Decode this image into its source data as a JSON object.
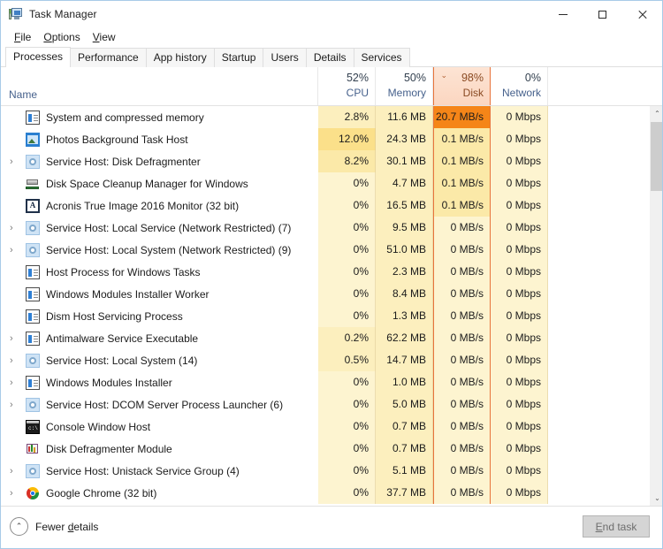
{
  "window": {
    "title": "Task Manager",
    "icon": "taskmanager-icon",
    "minimize": "—",
    "maximize": "□",
    "close": "✕"
  },
  "menu": [
    {
      "label": "File",
      "accel": "F"
    },
    {
      "label": "Options",
      "accel": "O"
    },
    {
      "label": "View",
      "accel": "V"
    }
  ],
  "tabs": [
    {
      "label": "Processes",
      "active": true
    },
    {
      "label": "Performance",
      "active": false
    },
    {
      "label": "App history",
      "active": false
    },
    {
      "label": "Startup",
      "active": false
    },
    {
      "label": "Users",
      "active": false
    },
    {
      "label": "Details",
      "active": false
    },
    {
      "label": "Services",
      "active": false
    }
  ],
  "columns": {
    "name_label": "Name",
    "metrics": [
      {
        "key": "cpu",
        "percent": "52%",
        "label": "CPU",
        "sorted": false
      },
      {
        "key": "memory",
        "percent": "50%",
        "label": "Memory",
        "sorted": false
      },
      {
        "key": "disk",
        "percent": "98%",
        "label": "Disk",
        "sorted": true,
        "sort_caret": "⌄"
      },
      {
        "key": "network",
        "percent": "0%",
        "label": "Network",
        "sorted": false
      }
    ]
  },
  "accent": {
    "sort_border": "#e8743c",
    "sort_header_bg": "#fbd6c0",
    "heat_max": "#f58518",
    "heat_base": "#fdf4d0"
  },
  "processes": [
    {
      "name": "System and compressed memory",
      "icon": "system-icon",
      "expandable": false,
      "cpu": "2.8%",
      "memory": "11.6 MB",
      "disk": "20.7 MB/s",
      "network": "0 Mbps",
      "cpu_heat": "h1",
      "mem_heat": "h1",
      "disk_heat": "h5",
      "net_heat": "h0"
    },
    {
      "name": "Photos Background Task Host",
      "icon": "photos-icon",
      "expandable": false,
      "cpu": "12.0%",
      "memory": "24.3 MB",
      "disk": "0.1 MB/s",
      "network": "0 Mbps",
      "cpu_heat": "h3",
      "mem_heat": "h1",
      "disk_heat": "h2",
      "net_heat": "h0"
    },
    {
      "name": "Service Host: Disk Defragmenter",
      "icon": "gear-icon",
      "expandable": true,
      "cpu": "8.2%",
      "memory": "30.1 MB",
      "disk": "0.1 MB/s",
      "network": "0 Mbps",
      "cpu_heat": "h2",
      "mem_heat": "h1",
      "disk_heat": "h2",
      "net_heat": "h0"
    },
    {
      "name": "Disk Space Cleanup Manager for Windows",
      "icon": "cleanup-icon",
      "expandable": false,
      "cpu": "0%",
      "memory": "4.7 MB",
      "disk": "0.1 MB/s",
      "network": "0 Mbps",
      "cpu_heat": "h0",
      "mem_heat": "h1",
      "disk_heat": "h2",
      "net_heat": "h0"
    },
    {
      "name": "Acronis True Image 2016 Monitor (32 bit)",
      "icon": "acronis-icon",
      "expandable": false,
      "cpu": "0%",
      "memory": "16.5 MB",
      "disk": "0.1 MB/s",
      "network": "0 Mbps",
      "cpu_heat": "h0",
      "mem_heat": "h1",
      "disk_heat": "h2",
      "net_heat": "h0"
    },
    {
      "name": "Service Host: Local Service (Network Restricted) (7)",
      "icon": "gear-icon",
      "expandable": true,
      "cpu": "0%",
      "memory": "9.5 MB",
      "disk": "0 MB/s",
      "network": "0 Mbps",
      "cpu_heat": "h0",
      "mem_heat": "h1",
      "disk_heat": "h0",
      "net_heat": "h0"
    },
    {
      "name": "Service Host: Local System (Network Restricted) (9)",
      "icon": "gear-icon",
      "expandable": true,
      "cpu": "0%",
      "memory": "51.0 MB",
      "disk": "0 MB/s",
      "network": "0 Mbps",
      "cpu_heat": "h0",
      "mem_heat": "h1",
      "disk_heat": "h0",
      "net_heat": "h0"
    },
    {
      "name": "Host Process for Windows Tasks",
      "icon": "system-icon",
      "expandable": false,
      "cpu": "0%",
      "memory": "2.3 MB",
      "disk": "0 MB/s",
      "network": "0 Mbps",
      "cpu_heat": "h0",
      "mem_heat": "h1",
      "disk_heat": "h0",
      "net_heat": "h0"
    },
    {
      "name": "Windows Modules Installer Worker",
      "icon": "system-icon",
      "expandable": false,
      "cpu": "0%",
      "memory": "8.4 MB",
      "disk": "0 MB/s",
      "network": "0 Mbps",
      "cpu_heat": "h0",
      "mem_heat": "h1",
      "disk_heat": "h0",
      "net_heat": "h0"
    },
    {
      "name": "Dism Host Servicing Process",
      "icon": "system-icon",
      "expandable": false,
      "cpu": "0%",
      "memory": "1.3 MB",
      "disk": "0 MB/s",
      "network": "0 Mbps",
      "cpu_heat": "h0",
      "mem_heat": "h1",
      "disk_heat": "h0",
      "net_heat": "h0"
    },
    {
      "name": "Antimalware Service Executable",
      "icon": "system-icon",
      "expandable": true,
      "cpu": "0.2%",
      "memory": "62.2 MB",
      "disk": "0 MB/s",
      "network": "0 Mbps",
      "cpu_heat": "h1",
      "mem_heat": "h1",
      "disk_heat": "h0",
      "net_heat": "h0"
    },
    {
      "name": "Service Host: Local System (14)",
      "icon": "gear-icon",
      "expandable": true,
      "cpu": "0.5%",
      "memory": "14.7 MB",
      "disk": "0 MB/s",
      "network": "0 Mbps",
      "cpu_heat": "h1",
      "mem_heat": "h1",
      "disk_heat": "h0",
      "net_heat": "h0"
    },
    {
      "name": "Windows Modules Installer",
      "icon": "system-icon",
      "expandable": true,
      "cpu": "0%",
      "memory": "1.0 MB",
      "disk": "0 MB/s",
      "network": "0 Mbps",
      "cpu_heat": "h0",
      "mem_heat": "h1",
      "disk_heat": "h0",
      "net_heat": "h0"
    },
    {
      "name": "Service Host: DCOM Server Process Launcher (6)",
      "icon": "gear-icon",
      "expandable": true,
      "cpu": "0%",
      "memory": "5.0 MB",
      "disk": "0 MB/s",
      "network": "0 Mbps",
      "cpu_heat": "h0",
      "mem_heat": "h1",
      "disk_heat": "h0",
      "net_heat": "h0"
    },
    {
      "name": "Console Window Host",
      "icon": "console-icon",
      "expandable": false,
      "cpu": "0%",
      "memory": "0.7 MB",
      "disk": "0 MB/s",
      "network": "0 Mbps",
      "cpu_heat": "h0",
      "mem_heat": "h1",
      "disk_heat": "h0",
      "net_heat": "h0"
    },
    {
      "name": "Disk Defragmenter Module",
      "icon": "defrag-icon",
      "expandable": false,
      "cpu": "0%",
      "memory": "0.7 MB",
      "disk": "0 MB/s",
      "network": "0 Mbps",
      "cpu_heat": "h0",
      "mem_heat": "h1",
      "disk_heat": "h0",
      "net_heat": "h0"
    },
    {
      "name": "Service Host: Unistack Service Group (4)",
      "icon": "gear-icon",
      "expandable": true,
      "cpu": "0%",
      "memory": "5.1 MB",
      "disk": "0 MB/s",
      "network": "0 Mbps",
      "cpu_heat": "h0",
      "mem_heat": "h1",
      "disk_heat": "h0",
      "net_heat": "h0"
    },
    {
      "name": "Google Chrome (32 bit)",
      "icon": "chrome-icon",
      "expandable": true,
      "cpu": "0%",
      "memory": "37.7 MB",
      "disk": "0 MB/s",
      "network": "0 Mbps",
      "cpu_heat": "h0",
      "mem_heat": "h1",
      "disk_heat": "h0",
      "net_heat": "h0"
    }
  ],
  "scrollbar": {
    "up_arrow": "⌃",
    "down_arrow": "⌄"
  },
  "statusbar": {
    "fewer_details": "Fewer details",
    "fewer_details_accel": "d",
    "fewer_details_caret": "⌃",
    "end_task": "End task",
    "end_task_accel": "E",
    "end_task_enabled": false
  }
}
